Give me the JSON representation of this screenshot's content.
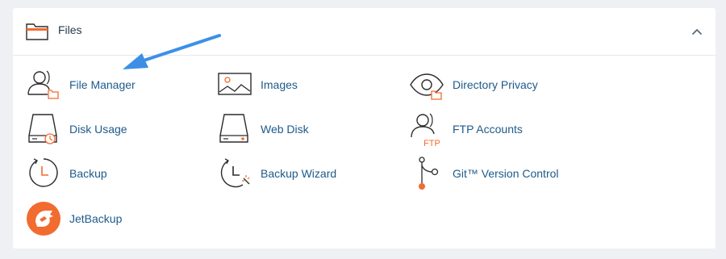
{
  "section": {
    "title": "Files",
    "folder_icon": "folder-icon",
    "collapse_icon": "chevron-up-icon"
  },
  "colors": {
    "link": "#1d5a8a",
    "accent": "#f26b2f",
    "arrow": "#3d8fe6"
  },
  "items": [
    {
      "label": "File Manager",
      "icon": "file-manager-icon"
    },
    {
      "label": "Images",
      "icon": "images-icon"
    },
    {
      "label": "Directory Privacy",
      "icon": "directory-privacy-icon"
    },
    {
      "label": "Disk Usage",
      "icon": "disk-usage-icon"
    },
    {
      "label": "Web Disk",
      "icon": "web-disk-icon"
    },
    {
      "label": "FTP Accounts",
      "icon": "ftp-accounts-icon"
    },
    {
      "label": "Backup",
      "icon": "backup-icon"
    },
    {
      "label": "Backup Wizard",
      "icon": "backup-wizard-icon"
    },
    {
      "label": "Git™ Version Control",
      "icon": "git-version-control-icon"
    },
    {
      "label": "JetBackup",
      "icon": "jetbackup-icon"
    }
  ],
  "ftp_badge": "FTP"
}
